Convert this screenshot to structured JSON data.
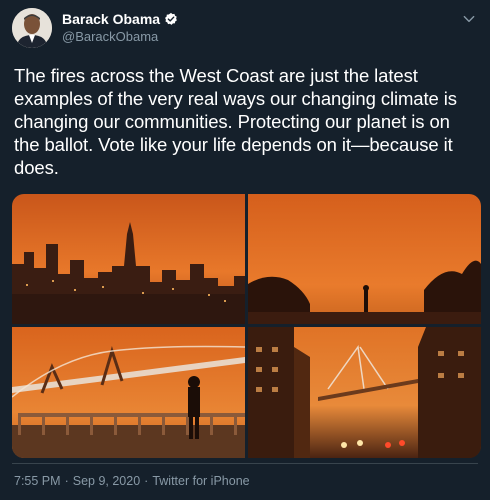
{
  "author": {
    "name": "Barack Obama",
    "handle": "@BarackObama",
    "verified": true
  },
  "tweet": {
    "text": "The fires across the West Coast are just the latest examples of the very real ways our changing climate is changing our communities. Protecting our planet is on the ballot. Vote like your life depends on it—because it does."
  },
  "media": {
    "photos": [
      {
        "subject": "san-francisco-skyline-orange-sky"
      },
      {
        "subject": "hilltop-overlook-orange-sky"
      },
      {
        "subject": "bay-bridge-person-standing"
      },
      {
        "subject": "city-street-bay-bridge-orange-sky"
      }
    ]
  },
  "footer": {
    "time": "7:55 PM",
    "separator": "·",
    "date": "Sep 9, 2020",
    "source": "Twitter for iPhone"
  },
  "colors": {
    "background": "#15202b",
    "secondary_text": "#8899a6",
    "verified": "#ffffff",
    "sky_orange": "#e46a1c"
  },
  "icons": {
    "verified": "verified-badge-icon",
    "menu": "chevron-down-icon"
  }
}
